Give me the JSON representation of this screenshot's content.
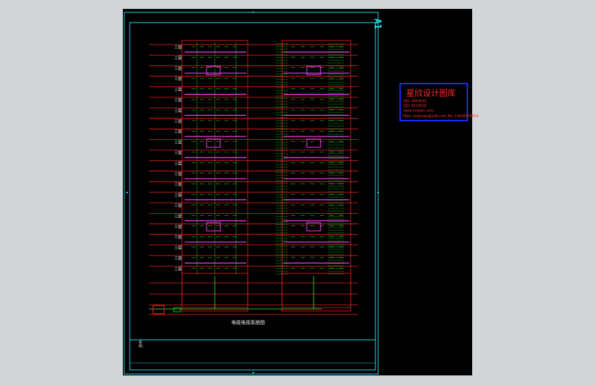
{
  "sheet": {
    "size_label": "A1",
    "drawing_caption": "电缆电视系统图",
    "side_note": "说明："
  },
  "watermark": {
    "title": "星欣设计图库",
    "lines": [
      "QQ: 2002010",
      "QQ: 3513516",
      "www.xingxin.com",
      "Mail: xxdesign@126.com  Tel: 13916978655"
    ]
  },
  "colors": {
    "background": "#d4d5d9",
    "sheet": "#000000",
    "frame": "#22e6f0",
    "floor_line": "#ff2020",
    "riser": "#ff40ff",
    "wiring": "#33ff33",
    "label": "#ffffff",
    "badge_border": "#1a2cff",
    "badge_text": "#ff2a2a"
  },
  "diagram": {
    "floor_labels": [
      "三层",
      "三层",
      "三层",
      "三层",
      "三层",
      "三层",
      "三层",
      "三层",
      "三层",
      "三层",
      "三层",
      "三层",
      "三层",
      "三层",
      "三层",
      "三层",
      "三层",
      "三层",
      "三层",
      "三层",
      "三层",
      "三层"
    ]
  }
}
